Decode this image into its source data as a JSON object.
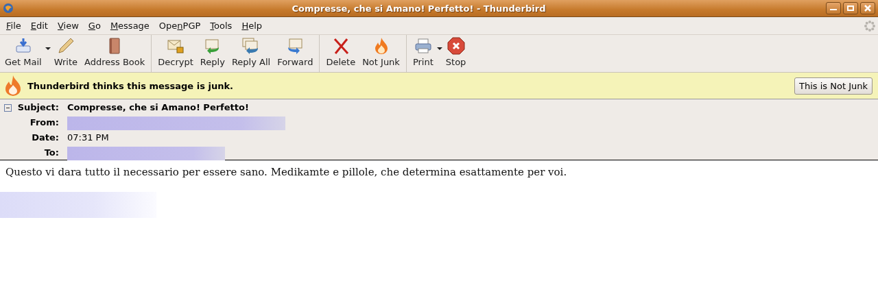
{
  "window": {
    "title": "Compresse, che si Amano! Perfetto! - Thunderbird"
  },
  "menu": [
    {
      "key": "F",
      "after": "ile"
    },
    {
      "key": "E",
      "after": "dit"
    },
    {
      "key": "V",
      "after": "iew"
    },
    {
      "key": "G",
      "after": "o"
    },
    {
      "key": "M",
      "after": "essage"
    },
    {
      "before": "Ope",
      "key": "n",
      "after": "PGP"
    },
    {
      "key": "T",
      "after": "ools"
    },
    {
      "key": "H",
      "after": "elp"
    }
  ],
  "toolbar": [
    [
      {
        "label": "Get Mail",
        "kind": "getmail",
        "dropdown": true
      },
      {
        "label": "Write",
        "kind": "write",
        "dropdown": false
      },
      {
        "label": "Address Book",
        "kind": "book",
        "dropdown": false
      }
    ],
    [
      {
        "label": "Decrypt",
        "kind": "decrypt",
        "dropdown": false
      },
      {
        "label": "Reply",
        "kind": "reply",
        "dropdown": false
      },
      {
        "label": "Reply All",
        "kind": "replyall",
        "dropdown": false
      },
      {
        "label": "Forward",
        "kind": "forward",
        "dropdown": false
      }
    ],
    [
      {
        "label": "Delete",
        "kind": "delete",
        "dropdown": false
      },
      {
        "label": "Not Junk",
        "kind": "flame",
        "dropdown": false
      }
    ],
    [
      {
        "label": "Print",
        "kind": "print",
        "dropdown": true
      },
      {
        "label": "Stop",
        "kind": "stop",
        "dropdown": false
      }
    ]
  ],
  "junk_bar": {
    "message": "Thunderbird thinks this message is junk.",
    "button": "This is Not Junk"
  },
  "headers": {
    "expanded": true,
    "fields": [
      {
        "label": "Subject:",
        "value": "Compresse, che si Amano! Perfetto!",
        "kind": "bold"
      },
      {
        "label": "From:",
        "kind": "redacted"
      },
      {
        "label": "Date:",
        "value": "07:31 PM",
        "kind": "text"
      },
      {
        "label": "To:",
        "kind": "redacted"
      }
    ]
  },
  "body": {
    "text": "Questo vi dara tutto il necessario per essere sano. Medikamte e pillole, che determina esattamente per voi.",
    "redacted": true
  }
}
